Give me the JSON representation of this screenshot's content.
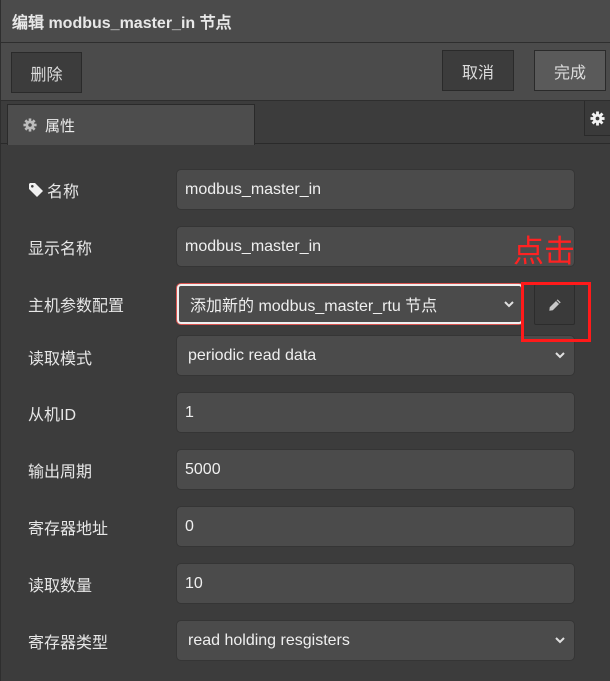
{
  "header": {
    "title": "编辑 modbus_master_in 节点"
  },
  "toolbar": {
    "delete_label": "删除",
    "cancel_label": "取消",
    "done_label": "完成"
  },
  "tabs": [
    {
      "label": "属性",
      "icon": "gear-icon",
      "active": true
    }
  ],
  "side_panel": {
    "icon": "gear-icon"
  },
  "form": {
    "name": {
      "label": "名称",
      "icon": "tag-icon",
      "value": "modbus_master_in"
    },
    "display_name": {
      "label": "显示名称",
      "value": "modbus_master_in"
    },
    "master_config": {
      "label": "主机参数配置",
      "value": "添加新的 modbus_master_rtu 节点",
      "edit_icon": "pencil-icon"
    },
    "read_mode": {
      "label": "读取模式",
      "value": "periodic read data"
    },
    "slave_id": {
      "label": "从机ID",
      "value": "1"
    },
    "output_period": {
      "label": "输出周期",
      "value": "5000"
    },
    "register_address": {
      "label": "寄存器地址",
      "value": "0"
    },
    "read_count": {
      "label": "读取数量",
      "value": "10"
    },
    "register_type": {
      "label": "寄存器类型",
      "value": "read holding resgisters"
    }
  },
  "annotation": {
    "text": "点击",
    "color": "#ff2222"
  },
  "colors": {
    "background": "#3c3c3c",
    "header": "#4b4b4b",
    "field": "#4b4b4b",
    "highlight": "#d9534f"
  }
}
